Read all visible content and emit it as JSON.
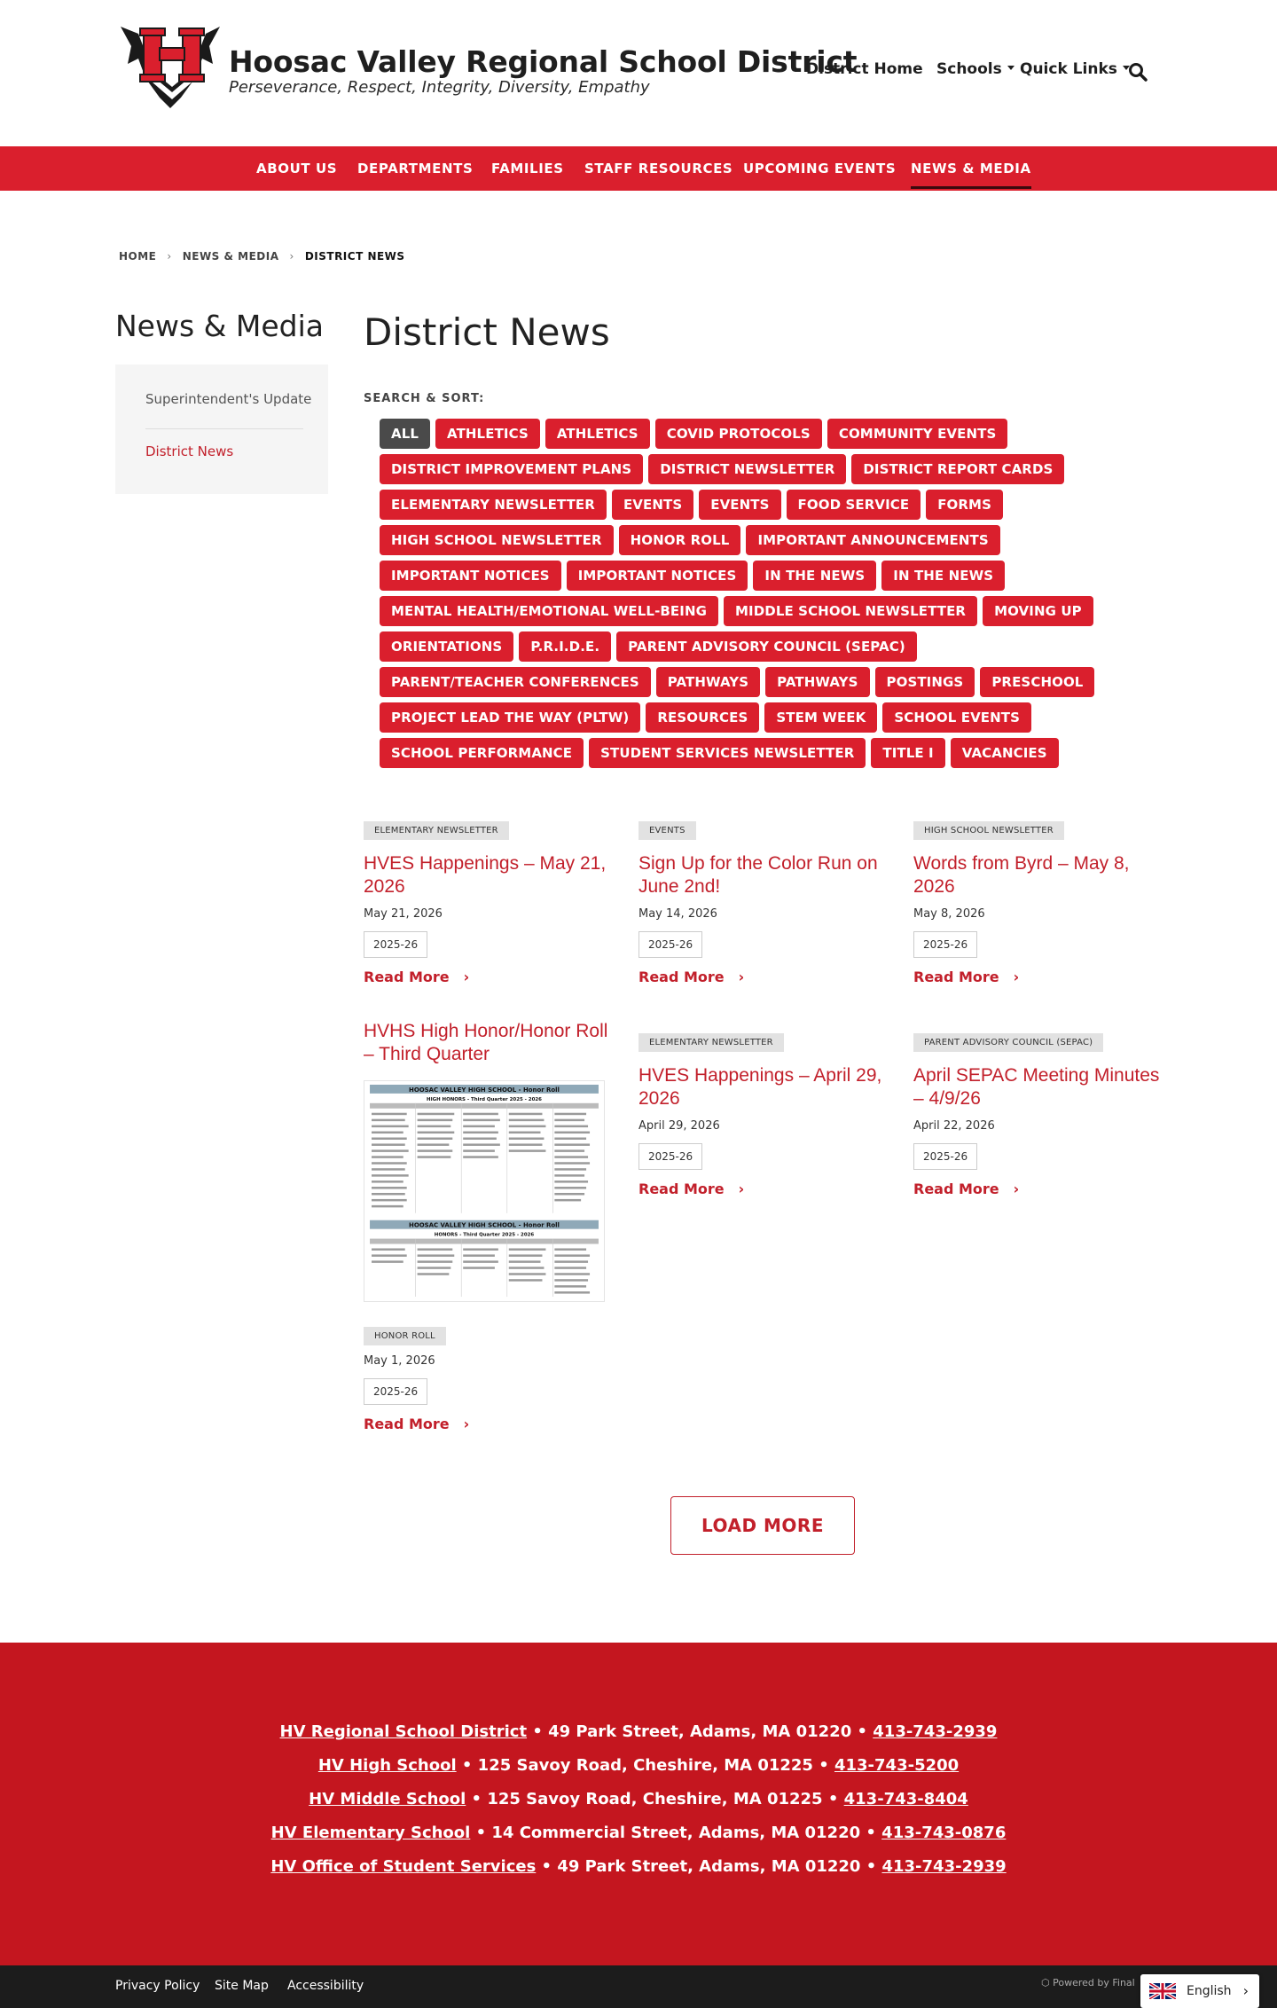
{
  "header": {
    "site_title": "Hoosac Valley Regional School District",
    "tagline": "Perseverance, Respect, Integrity, Diversity, Empathy",
    "nav": {
      "district_home": "District Home",
      "schools": "Schools",
      "quick_links": "Quick Links"
    }
  },
  "main_nav": {
    "items": [
      "ABOUT US",
      "DEPARTMENTS",
      "FAMILIES",
      "STAFF RESOURCES",
      "UPCOMING EVENTS",
      "NEWS & MEDIA"
    ],
    "active": "NEWS & MEDIA"
  },
  "breadcrumb": {
    "home": "HOME",
    "section": "NEWS & MEDIA",
    "current": "DISTRICT NEWS"
  },
  "sidebar": {
    "title": "News & Media",
    "items": [
      "Superintendent's Update",
      "District News"
    ]
  },
  "content": {
    "title": "District News",
    "sort_label": "SEARCH & SORT:",
    "filters": [
      "ALL",
      "ATHLETICS",
      "ATHLETICS",
      "COVID PROTOCOLS",
      "COMMUNITY EVENTS",
      "DISTRICT IMPROVEMENT PLANS",
      "DISTRICT NEWSLETTER",
      "DISTRICT REPORT CARDS",
      "ELEMENTARY NEWSLETTER",
      "EVENTS",
      "EVENTS",
      "FOOD SERVICE",
      "FORMS",
      "HIGH SCHOOL NEWSLETTER",
      "HONOR ROLL",
      "IMPORTANT ANNOUNCEMENTS",
      "IMPORTANT NOTICES",
      "IMPORTANT NOTICES",
      "IN THE NEWS",
      "IN THE NEWS",
      "MENTAL HEALTH/EMOTIONAL WELL-BEING",
      "MIDDLE SCHOOL NEWSLETTER",
      "MOVING UP",
      "ORIENTATIONS",
      "P.R.I.D.E.",
      "PARENT ADVISORY COUNCIL (SEPAC)",
      "PARENT/TEACHER CONFERENCES",
      "PATHWAYS",
      "PATHWAYS",
      "POSTINGS",
      "PRESCHOOL",
      "PROJECT LEAD THE WAY (PLTW)",
      "RESOURCES",
      "STEM WEEK",
      "SCHOOL EVENTS",
      "SCHOOL PERFORMANCE",
      "STUDENT SERVICES NEWSLETTER",
      "TITLE I",
      "VACANCIES"
    ],
    "selected_filter": "ALL",
    "read_more": "Read More",
    "load_more": "LOAD MORE"
  },
  "cards": [
    {
      "tag": "ELEMENTARY NEWSLETTER",
      "title": "HVES Happenings – May 21, 2026",
      "date": "May 21, 2026",
      "chip": "2025-26"
    },
    {
      "tag": "EVENTS",
      "title": "Sign Up for the Color Run on June 2nd!",
      "date": "May 14, 2026",
      "chip": "2025-26"
    },
    {
      "tag": "HIGH SCHOOL NEWSLETTER",
      "title": "Words from Byrd – May 8, 2026",
      "date": "May 8, 2026",
      "chip": "2025-26"
    },
    {
      "tag": "HONOR ROLL",
      "title": "HVHS High Honor/Honor Roll – Third Quarter",
      "date": "May 1, 2026",
      "chip": "2025-26",
      "image": {
        "heading_1": "HOOSAC VALLEY HIGH SCHOOL - Honor Roll",
        "sub_1": "HIGH HONORS - Third Quarter 2025 - 2026",
        "heading_2": "HOOSAC VALLEY HIGH SCHOOL - Honor Roll",
        "sub_2": "HONORS - Third Quarter 2025 - 2026"
      }
    },
    {
      "tag": "ELEMENTARY NEWSLETTER",
      "title": "HVES Happenings – April 29, 2026",
      "date": "April 29, 2026",
      "chip": "2025-26"
    },
    {
      "tag": "PARENT ADVISORY COUNCIL (SEPAC)",
      "title": "April SEPAC Meeting Minutes – 4/9/26",
      "date": "April 22, 2026",
      "chip": "2025-26"
    }
  ],
  "footer": {
    "lines": [
      {
        "name": "HV Regional School District",
        "address": " • 49 Park Street, Adams, MA 01220 • ",
        "phone": "413-743-2939"
      },
      {
        "name": "HV High School",
        "address": " • 125 Savoy Road, Cheshire, MA 01225 • ",
        "phone": "413-743-5200"
      },
      {
        "name": "HV Middle School",
        "address": " • 125 Savoy Road, Cheshire, MA 01225 • ",
        "phone": "413-743-8404"
      },
      {
        "name": "HV Elementary School",
        "address": " • 14 Commercial Street, Adams, MA 01220 • ",
        "phone": "413-743-0876"
      },
      {
        "name": "HV Office of Student Services",
        "address": " • 49 Park Street, Adams, MA 01220 • ",
        "phone": "413-743-2939"
      }
    ],
    "links": [
      "Privacy Policy",
      "Site Map",
      "Accessibility"
    ],
    "powered_by": "Powered by Final",
    "language": "English"
  },
  "colors": {
    "brand_red": "#da1f2d",
    "link_red": "#c2202b",
    "footer_red": "#c4161f",
    "selected_filter": "#4a4a4a"
  },
  "icons": [
    "logo-h-emblem",
    "search-icon",
    "caret-down-icon",
    "chevron-right-icon",
    "uk-flag-icon"
  ]
}
